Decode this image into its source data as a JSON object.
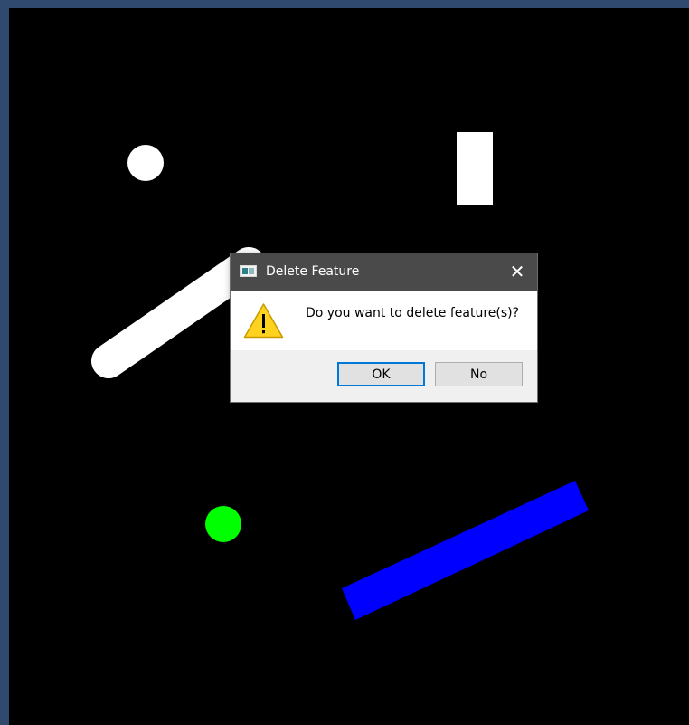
{
  "dialog": {
    "title": "Delete Feature",
    "close_glyph": "✕",
    "message": "Do you want to delete feature(s)?",
    "ok_label": "OK",
    "no_label": "No",
    "icon": "warning-icon"
  },
  "colors": {
    "background": "#000000",
    "white_shape": "#ffffff",
    "green_shape": "#00ff00",
    "blue_shape": "#0000ff",
    "titlebar": "#4a4a4a",
    "ok_focus_border": "#0078d7"
  }
}
